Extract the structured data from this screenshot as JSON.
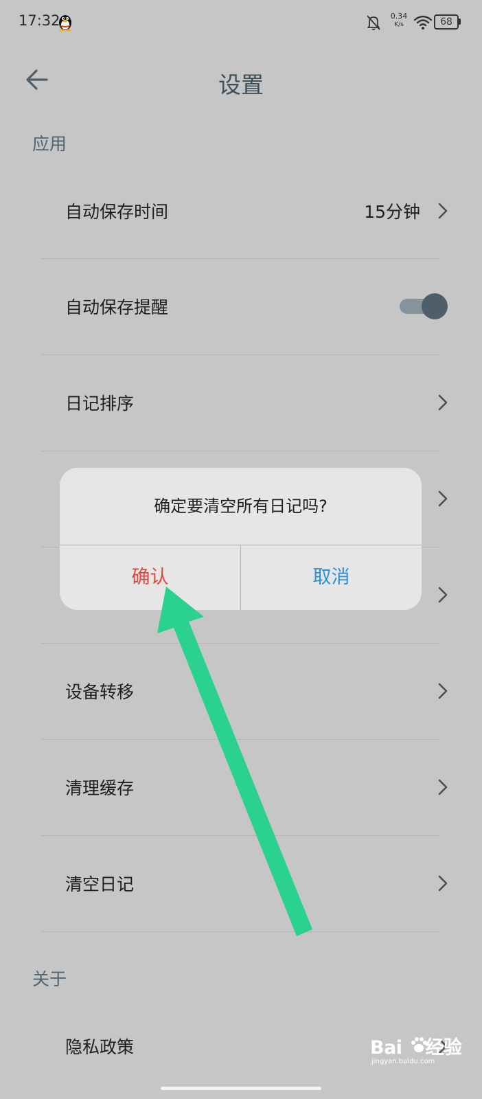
{
  "status_bar": {
    "time": "17:32",
    "net_speed_value": "0.34",
    "net_speed_unit": "K/s",
    "battery": "68"
  },
  "header": {
    "title": "设置"
  },
  "sections": {
    "app": "应用",
    "about": "关于"
  },
  "settings": {
    "auto_save_time": {
      "label": "自动保存时间",
      "value": "15分钟"
    },
    "auto_save_reminder": {
      "label": "自动保存提醒",
      "enabled": true
    },
    "diary_sort": {
      "label": "日记排序"
    },
    "device_transfer": {
      "label": "设备转移"
    },
    "clear_cache": {
      "label": "清理缓存"
    },
    "clear_diary": {
      "label": "清空日记"
    },
    "privacy_policy": {
      "label": "隐私政策"
    }
  },
  "dialog": {
    "message": "确定要清空所有日记吗?",
    "confirm_label": "确认",
    "cancel_label": "取消"
  },
  "watermark": {
    "main_left": "Bai",
    "main_right": "经验",
    "sub": "jingyan.baidu.com"
  },
  "colors": {
    "background": "#c6c6c6",
    "title": "#3e4f5c",
    "section_header": "#4f6472",
    "toggle_on": "#4e5f6b",
    "dialog_bg": "#e6e6e6",
    "confirm": "#e0473f",
    "cancel": "#2f8fd6",
    "annotation_arrow": "#2ad18f"
  },
  "icons": {
    "status_left": "qq-penguin-icon",
    "status_right": [
      "bell-off-icon",
      "wifi-icon",
      "battery-icon"
    ],
    "back": "arrow-left-icon",
    "row_chevron": "chevron-right-icon",
    "annotation": "green-arrow-annotation"
  }
}
